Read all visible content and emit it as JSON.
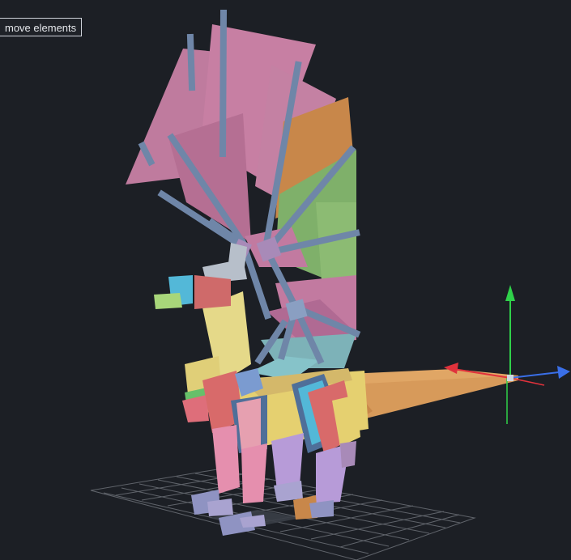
{
  "toolbar": {
    "mode_label": "move elements"
  },
  "colors": {
    "background": "#1c1f25",
    "grid": "#7c8088",
    "axis_x": "#e0323c",
    "axis_y": "#2fd14a",
    "axis_z": "#3a6fe8",
    "bone": "#6f86a8",
    "wing_pink": "#c77fa3",
    "wing_orange": "#c8874a",
    "wing_green": "#7fb06a",
    "body_yellow": "#e5d989",
    "tail_orange": "#d79a5a",
    "leg_pink": "#e58fae",
    "leg_purple": "#b79bd8"
  },
  "icons": {
    "gizmo": "translate-gizmo-icon"
  }
}
